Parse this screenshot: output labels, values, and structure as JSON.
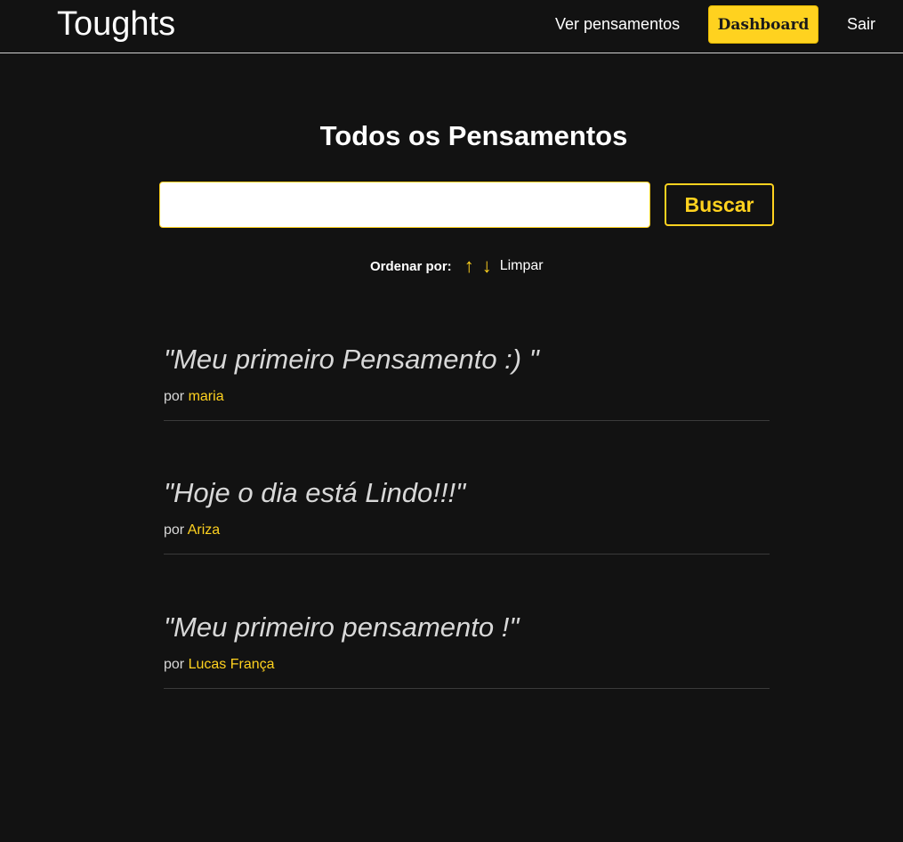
{
  "navbar": {
    "brand": "Toughts",
    "ver_pensamentos": "Ver pensamentos",
    "dashboard": "Dashboard",
    "sair": "Sair"
  },
  "main": {
    "title": "Todos os Pensamentos",
    "search": {
      "value": "",
      "button_label": "Buscar"
    },
    "order": {
      "label": "Ordenar por:",
      "asc_icon": "↑",
      "desc_icon": "↓",
      "clear_label": "Limpar"
    },
    "thoughts": [
      {
        "quote": "\"Meu primeiro Pensamento :) \"",
        "by_label": "por",
        "author": "maria"
      },
      {
        "quote": "\"Hoje o dia está Lindo!!!\"",
        "by_label": "por",
        "author": "Ariza"
      },
      {
        "quote": "\"Meu primeiro pensamento !\"",
        "by_label": "por",
        "author": "Lucas França"
      }
    ]
  },
  "colors": {
    "background": "#121212",
    "accent": "#ffd21f",
    "text": "#ffffff",
    "muted_text": "#d8d8d8"
  }
}
